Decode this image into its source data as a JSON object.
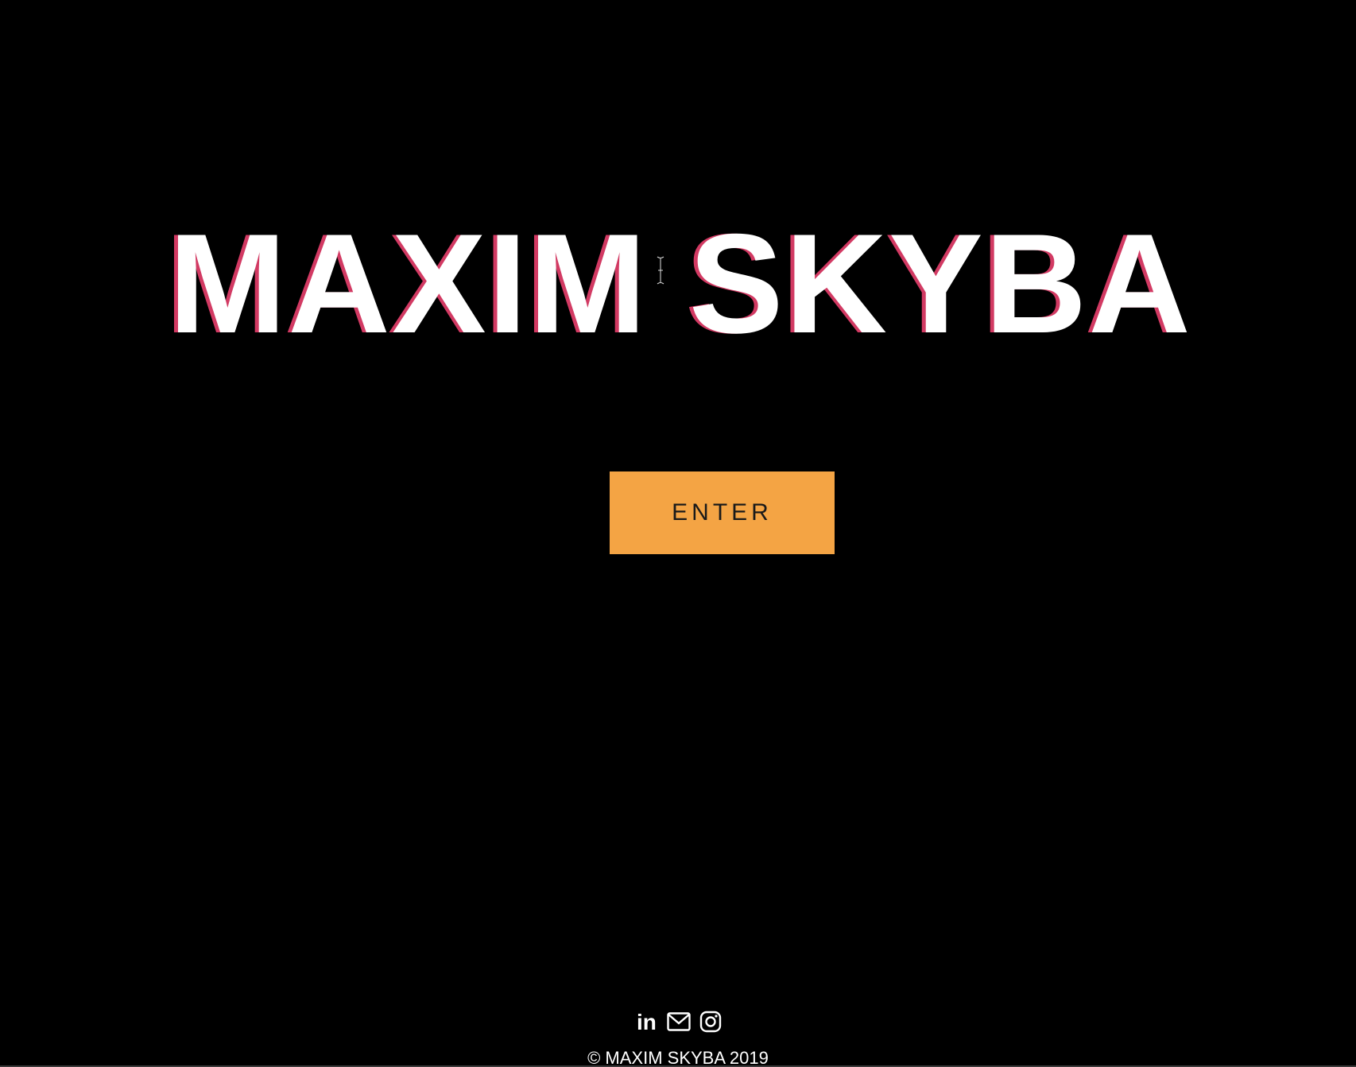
{
  "hero": {
    "title": "MAXIM SKYBA"
  },
  "enter_button": {
    "label": "ENTER"
  },
  "social": {
    "icons": [
      "linkedin-icon",
      "mail-icon",
      "instagram-icon"
    ],
    "linkedin_text": "in"
  },
  "footer": {
    "copyright": "© MAXIM SKYBA 2019"
  },
  "colors": {
    "background": "#000000",
    "title": "#ffffff",
    "title_shadow": "#d23a63",
    "button": "#f4a444",
    "button_text": "#1a1a1a"
  }
}
